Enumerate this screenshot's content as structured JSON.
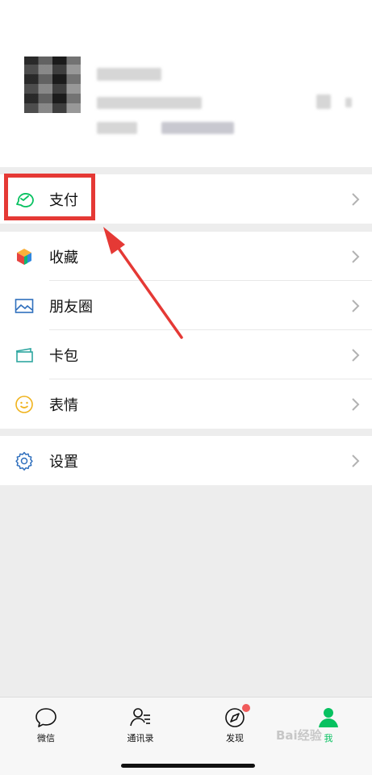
{
  "menu": {
    "pay": "支付",
    "favorites": "收藏",
    "moments": "朋友圈",
    "cards": "卡包",
    "stickers": "表情",
    "settings": "设置"
  },
  "tabs": [
    {
      "label": "微信",
      "icon": "chat-bubble-icon"
    },
    {
      "label": "通讯录",
      "icon": "contacts-icon"
    },
    {
      "label": "发现",
      "icon": "compass-icon"
    },
    {
      "label": "我",
      "icon": "person-icon"
    }
  ],
  "watermark": "Bai经验",
  "colors": {
    "accent": "#07c160",
    "highlight": "#e53935",
    "badge": "#f15b5b"
  }
}
